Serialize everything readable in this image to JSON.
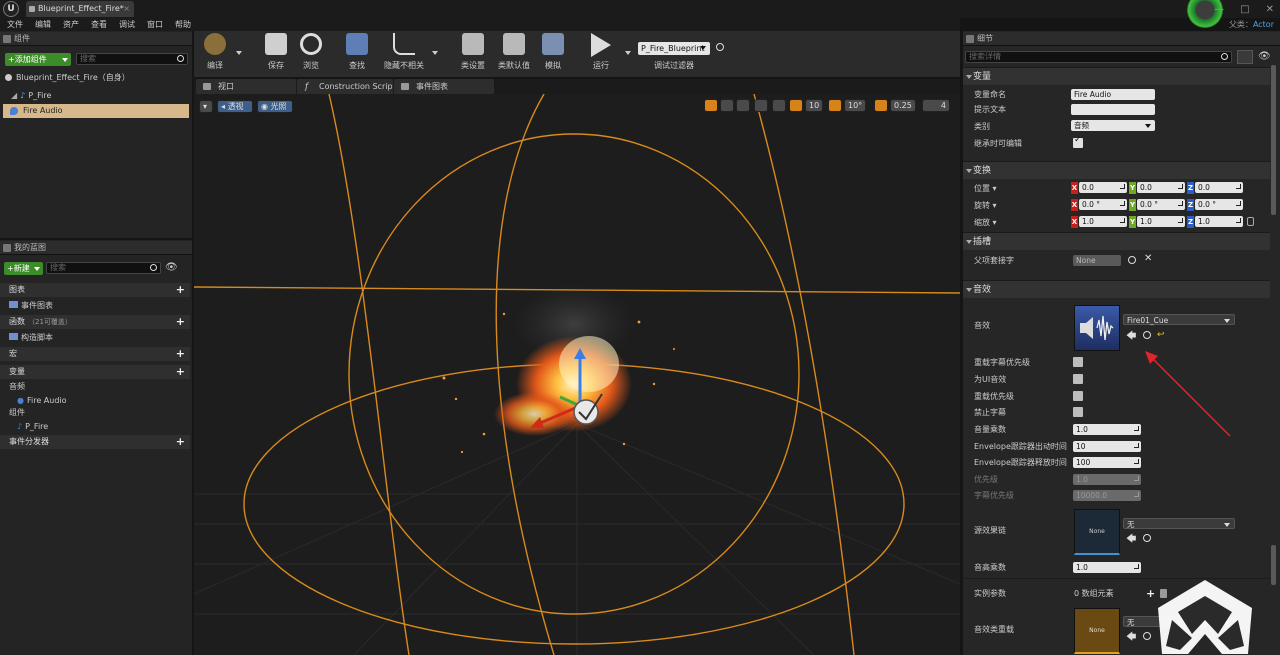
{
  "window": {
    "tab_title": "Blueprint_Effect_Fire*",
    "logo": "U",
    "controls": [
      "—",
      "□",
      "✕"
    ],
    "parent_class_label": "父类：",
    "parent_class_value": "Actor"
  },
  "menu": [
    "文件",
    "编辑",
    "资产",
    "查看",
    "调试",
    "窗口",
    "帮助"
  ],
  "components": {
    "title": "组件",
    "add_button": "+添加组件",
    "search_placeholder": "搜索",
    "root": "Blueprint_Effect_Fire（自身）",
    "items": [
      "P_Fire",
      "Fire Audio"
    ]
  },
  "my_blueprint": {
    "title": "我的蓝图",
    "new_button": "+新建",
    "search_placeholder": "搜索",
    "categories": {
      "graphs": "图表",
      "event_graph": "事件图表",
      "functions": "函数",
      "functions_override": "（21可覆盖）",
      "construction": "构造脚本",
      "macros": "宏",
      "variables": "变量",
      "audio_group": "音频",
      "fire_audio": "Fire Audio",
      "components_group": "组件",
      "p_fire": "P_Fire",
      "dispatchers": "事件分发器"
    }
  },
  "toolbar": {
    "compile": "编译",
    "save": "保存",
    "browse": "浏览",
    "find": "查找",
    "hide_unrelated": "隐藏不相关",
    "class_settings": "类设置",
    "class_defaults": "类默认值",
    "simulate": "模拟",
    "run": "运行",
    "debug_object": "P_Fire_Blueprint",
    "debug_filter": "调试过滤器"
  },
  "viewport_tabs": [
    "视口",
    "Construction Scrip",
    "事件图表"
  ],
  "viewport": {
    "perspective": "透视",
    "lit": "光照",
    "grid_snap": "10",
    "rot_snap": "10°",
    "scale_snap": "0.25",
    "cam_speed": "4"
  },
  "details": {
    "title": "细节",
    "search_placeholder": "搜索详情",
    "sections": {
      "variable": "变量",
      "transform": "变换",
      "socket": "插槽",
      "sound": "音效"
    },
    "variable": {
      "name_label": "变量命名",
      "name_value": "Fire Audio",
      "tooltip_label": "提示文本",
      "tooltip_value": "",
      "category_label": "类别",
      "category_value": "音频",
      "editable_label": "继承时可编辑",
      "editable_checked": true
    },
    "transform": {
      "location_label": "位置",
      "rotation_label": "旋转",
      "scale_label": "缩放",
      "location": [
        "0.0",
        "0.0",
        "0.0"
      ],
      "rotation": [
        "0.0 °",
        "0.0 °",
        "0.0 °"
      ],
      "scale": [
        "1.0",
        "1.0",
        "1.0"
      ],
      "axes": [
        "X",
        "Y",
        "Z"
      ]
    },
    "socket": {
      "parent_socket_label": "父项套接字",
      "parent_socket_value": "None"
    },
    "sound": {
      "sound_label": "音效",
      "sound_asset": "Fire01_Cue",
      "override_subtitle_priority": "重载字幕优先级",
      "is_ui_sound": "为UI音效",
      "override_priority": "重载优先级",
      "suppress_subtitles": "禁止字幕",
      "volume_multiplier_label": "音量乘数",
      "volume_multiplier": "1.0",
      "envelope_attack_label": "Envelope跟踪器出动时间",
      "envelope_attack": "10",
      "envelope_release_label": "Envelope跟踪器释放时间",
      "envelope_release": "100",
      "priority_label": "优先级",
      "priority": "1.0",
      "subtitle_priority_label": "字幕优先级",
      "subtitle_priority": "10000.0",
      "source_effect_chain_label": "源效果链",
      "source_effect_chain_value": "无",
      "thumb_none": "None",
      "pitch_multiplier_label": "音高乘数",
      "pitch_multiplier": "1.0",
      "instance_params_label": "实例参数",
      "instance_params_value": "0 数组元素",
      "sound_class_override_label": "音效类重载",
      "sound_class_override_value": "无",
      "thumb_none2": "None"
    }
  },
  "colors": {
    "accent_orange": "#e08a1c",
    "green_button": "#3c8c2a",
    "annotation_arrow": "#e0252a",
    "selection": "#d7b88a"
  }
}
